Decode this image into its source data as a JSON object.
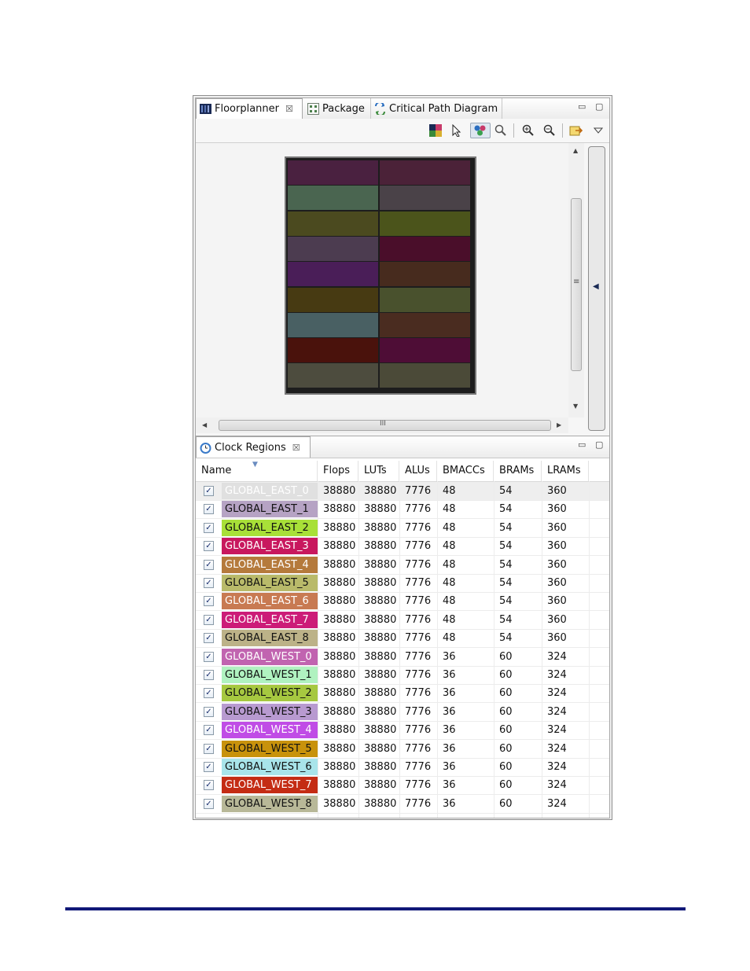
{
  "floorplanner": {
    "tabs": [
      {
        "label": "Floorplanner",
        "close": "☒",
        "icon": "floorplanner-icon"
      },
      {
        "label": "Package",
        "icon": "package-icon"
      },
      {
        "label": "Critical Path Diagram",
        "icon": "critical-path-icon"
      }
    ],
    "window_controls": {
      "minimize": "▭",
      "maximize": "▢"
    },
    "toolbar": [
      "color-map-icon",
      "select-pointer-icon",
      "clock-regions-icon",
      "zoom-icon",
      "zoom-in-icon",
      "zoom-out-icon",
      "export-icon",
      "view-menu-icon"
    ],
    "hscroll_label": "III",
    "vscroll_label": "≡",
    "sidebar_arrow": "◀",
    "chip_regions": [
      [
        "#4a2140",
        "#4b2238"
      ],
      [
        "#4a6550",
        "#4a4248"
      ],
      [
        "#4b4a1f",
        "#4b541b"
      ],
      [
        "#4c3c50",
        "#4a0e2a"
      ],
      [
        "#4a1e58",
        "#472b1e"
      ],
      [
        "#473a12",
        "#49512d"
      ],
      [
        "#496063",
        "#4a2c20"
      ],
      [
        "#4a120c",
        "#4e0d36"
      ],
      [
        "#4d4c3e",
        "#4b4a38"
      ]
    ]
  },
  "clock_regions": {
    "tab": {
      "label": "Clock Regions",
      "close": "☒",
      "icon": "clock-regions-icon"
    },
    "window_controls": {
      "minimize": "▭",
      "maximize": "▢"
    },
    "columns": [
      "Name",
      "Flops",
      "LUTs",
      "ALUs",
      "BMACCs",
      "BRAMs",
      "LRAMs"
    ],
    "rows": [
      {
        "name": "GLOBAL_EAST_0",
        "color": "#e0e0e0",
        "text": "#ffffff",
        "flops": "38880",
        "luts": "38880",
        "alus": "7776",
        "bmaccs": "48",
        "brams": "54",
        "lrams": "360",
        "checked": "✓"
      },
      {
        "name": "GLOBAL_EAST_1",
        "color": "#b6a3c4",
        "text": "#111111",
        "flops": "38880",
        "luts": "38880",
        "alus": "7776",
        "bmaccs": "48",
        "brams": "54",
        "lrams": "360",
        "checked": "✓"
      },
      {
        "name": "GLOBAL_EAST_2",
        "color": "#a8e038",
        "text": "#111111",
        "flops": "38880",
        "luts": "38880",
        "alus": "7776",
        "bmaccs": "48",
        "brams": "54",
        "lrams": "360",
        "checked": "✓"
      },
      {
        "name": "GLOBAL_EAST_3",
        "color": "#c8185e",
        "text": "#ffffff",
        "flops": "38880",
        "luts": "38880",
        "alus": "7776",
        "bmaccs": "48",
        "brams": "54",
        "lrams": "360",
        "checked": "✓"
      },
      {
        "name": "GLOBAL_EAST_4",
        "color": "#b57a3c",
        "text": "#ffffff",
        "flops": "38880",
        "luts": "38880",
        "alus": "7776",
        "bmaccs": "48",
        "brams": "54",
        "lrams": "360",
        "checked": "✓"
      },
      {
        "name": "GLOBAL_EAST_5",
        "color": "#b9ba6a",
        "text": "#111111",
        "flops": "38880",
        "luts": "38880",
        "alus": "7776",
        "bmaccs": "48",
        "brams": "54",
        "lrams": "360",
        "checked": "✓"
      },
      {
        "name": "GLOBAL_EAST_6",
        "color": "#c87a52",
        "text": "#ffffff",
        "flops": "38880",
        "luts": "38880",
        "alus": "7776",
        "bmaccs": "48",
        "brams": "54",
        "lrams": "360",
        "checked": "✓"
      },
      {
        "name": "GLOBAL_EAST_7",
        "color": "#cc1c78",
        "text": "#ffffff",
        "flops": "38880",
        "luts": "38880",
        "alus": "7776",
        "bmaccs": "48",
        "brams": "54",
        "lrams": "360",
        "checked": "✓"
      },
      {
        "name": "GLOBAL_EAST_8",
        "color": "#bcb288",
        "text": "#111111",
        "flops": "38880",
        "luts": "38880",
        "alus": "7776",
        "bmaccs": "48",
        "brams": "54",
        "lrams": "360",
        "checked": "✓"
      },
      {
        "name": "GLOBAL_WEST_0",
        "color": "#c164b0",
        "text": "#ffffff",
        "flops": "38880",
        "luts": "38880",
        "alus": "7776",
        "bmaccs": "36",
        "brams": "60",
        "lrams": "324",
        "checked": "✓"
      },
      {
        "name": "GLOBAL_WEST_1",
        "color": "#b0f2c0",
        "text": "#111111",
        "flops": "38880",
        "luts": "38880",
        "alus": "7776",
        "bmaccs": "36",
        "brams": "60",
        "lrams": "324",
        "checked": "✓"
      },
      {
        "name": "GLOBAL_WEST_2",
        "color": "#a6c840",
        "text": "#111111",
        "flops": "38880",
        "luts": "38880",
        "alus": "7776",
        "bmaccs": "36",
        "brams": "60",
        "lrams": "324",
        "checked": "✓"
      },
      {
        "name": "GLOBAL_WEST_3",
        "color": "#b89ad0",
        "text": "#111111",
        "flops": "38880",
        "luts": "38880",
        "alus": "7776",
        "bmaccs": "36",
        "brams": "60",
        "lrams": "324",
        "checked": "✓"
      },
      {
        "name": "GLOBAL_WEST_4",
        "color": "#c04ce6",
        "text": "#ffffff",
        "flops": "38880",
        "luts": "38880",
        "alus": "7776",
        "bmaccs": "36",
        "brams": "60",
        "lrams": "324",
        "checked": "✓"
      },
      {
        "name": "GLOBAL_WEST_5",
        "color": "#c8920c",
        "text": "#111111",
        "flops": "38880",
        "luts": "38880",
        "alus": "7776",
        "bmaccs": "36",
        "brams": "60",
        "lrams": "324",
        "checked": "✓"
      },
      {
        "name": "GLOBAL_WEST_6",
        "color": "#a8e4ea",
        "text": "#111111",
        "flops": "38880",
        "luts": "38880",
        "alus": "7776",
        "bmaccs": "36",
        "brams": "60",
        "lrams": "324",
        "checked": "✓"
      },
      {
        "name": "GLOBAL_WEST_7",
        "color": "#c42c14",
        "text": "#ffffff",
        "flops": "38880",
        "luts": "38880",
        "alus": "7776",
        "bmaccs": "36",
        "brams": "60",
        "lrams": "324",
        "checked": "✓"
      },
      {
        "name": "GLOBAL_WEST_8",
        "color": "#b8b898",
        "text": "#111111",
        "flops": "38880",
        "luts": "38880",
        "alus": "7776",
        "bmaccs": "36",
        "brams": "60",
        "lrams": "324",
        "checked": "✓"
      }
    ]
  },
  "page_rule_color": "#101878"
}
